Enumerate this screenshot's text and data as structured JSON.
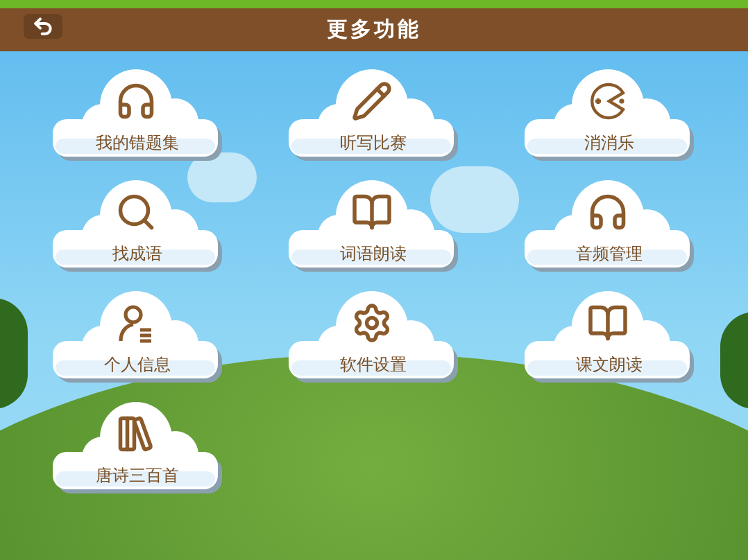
{
  "header": {
    "title": "更多功能"
  },
  "features": [
    {
      "label": "我的错题集",
      "kind": "headphones"
    },
    {
      "label": "听写比赛",
      "kind": "pencil"
    },
    {
      "label": "消消乐",
      "kind": "pacman"
    },
    {
      "label": "找成语",
      "kind": "search"
    },
    {
      "label": "词语朗读",
      "kind": "book"
    },
    {
      "label": "音频管理",
      "kind": "headphones"
    },
    {
      "label": "个人信息",
      "kind": "profile"
    },
    {
      "label": "软件设置",
      "kind": "gear"
    },
    {
      "label": "课文朗读",
      "kind": "audiobook"
    },
    {
      "label": "唐诗三百首",
      "kind": "books"
    }
  ]
}
